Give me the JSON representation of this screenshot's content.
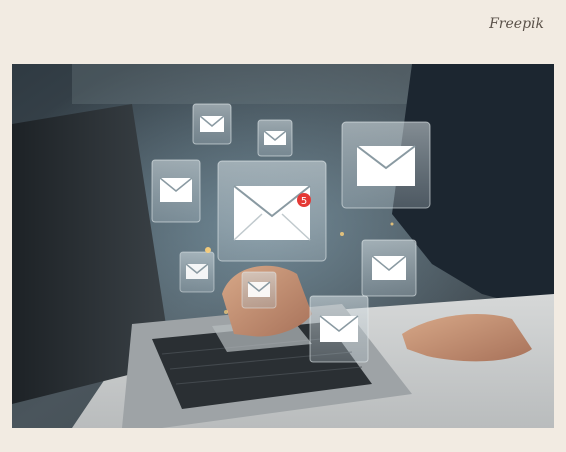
{
  "credit": {
    "text": "Freepik"
  },
  "photo": {
    "notification_badge": "5"
  },
  "colors": {
    "page_background": "#f2ebe2",
    "credit_text": "#5a5149",
    "badge": "#e53935"
  }
}
